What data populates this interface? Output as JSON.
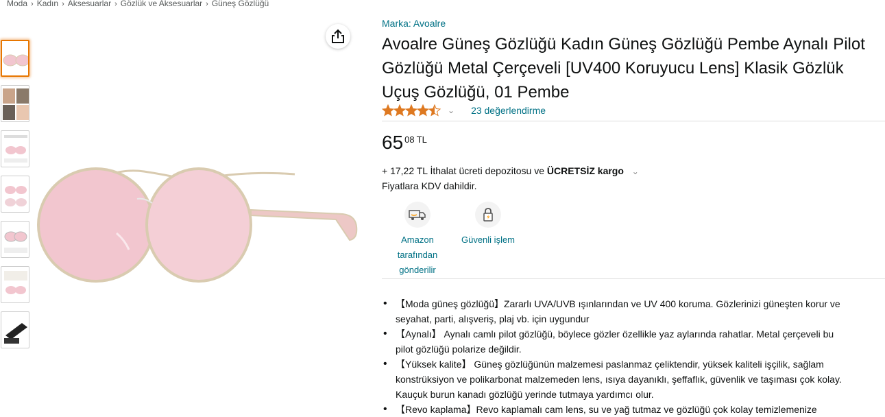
{
  "breadcrumb": [
    "Moda",
    "Kadın",
    "Aksesuarlar",
    "Gözlük ve Aksesuarlar",
    "Güneş Gözlüğü"
  ],
  "product": {
    "brand": "Marka: Avoalre",
    "title": "Avoalre Güneş Gözlüğü Kadın Güneş Gözlüğü Pembe Aynalı Pilot Gözlüğü Metal Çerçeveli [UV400 Koruyucu Lens] Klasik Gözlük Uçuş Gözlüğü, 01 Pembe",
    "rating": 4.5,
    "reviews": "23 değerlendirme",
    "price_whole": "65",
    "price_fraction": "08",
    "price_currency": "TL",
    "shipping_prefix": "+ 17,22 TL İthalat ücreti depozitosu ve ",
    "shipping_bold": "ÜCRETSİZ kargo",
    "vat": "Fiyatlara KDV dahildir."
  },
  "features": [
    {
      "icon": "delivery-truck-icon",
      "lines": [
        "Amazon",
        "tarafından",
        "gönderilir"
      ]
    },
    {
      "icon": "lock-icon",
      "lines": [
        "Güvenli işlem"
      ]
    }
  ],
  "bullets": [
    [
      "【Moda güneş gözlüğü】Zararlı UVA/UVB ışınlarından ve UV 400 koruma. Gözlerinizi güneşten korur ve",
      "seyahat, parti, alışveriş, plaj vb. için uygundur"
    ],
    [
      "【Aynalı】 Aynalı camlı pilot gözlüğü, böylece gözler özellikle yaz aylarında rahatlar. Metal çerçeveli bu",
      "pilot gözlüğü polarize değildir."
    ],
    [
      "【Yüksek kalite】 Güneş gözlüğünün malzemesi paslanmaz çeliktendir, yüksek kaliteli işçilik, sağlam",
      "konstrüksiyon ve polikarbonat malzemeden lens, ısıya dayanıklı, şeffaflık, güvenlik ve taşıması çok kolay.",
      "Kauçuk burun kanadı gözlüğü yerinde tutmaya yardımcı olur."
    ],
    [
      "【Revo kaplama】Revo kaplamalı cam lens, su ve yağ tutmaz ve gözlüğü çok kolay temizlemenize"
    ]
  ],
  "colors": {
    "link": "#007185",
    "star": "#de7921",
    "selected_border": "#e77600",
    "lens": "#f2c6cf",
    "frame": "#d9cbb0"
  }
}
